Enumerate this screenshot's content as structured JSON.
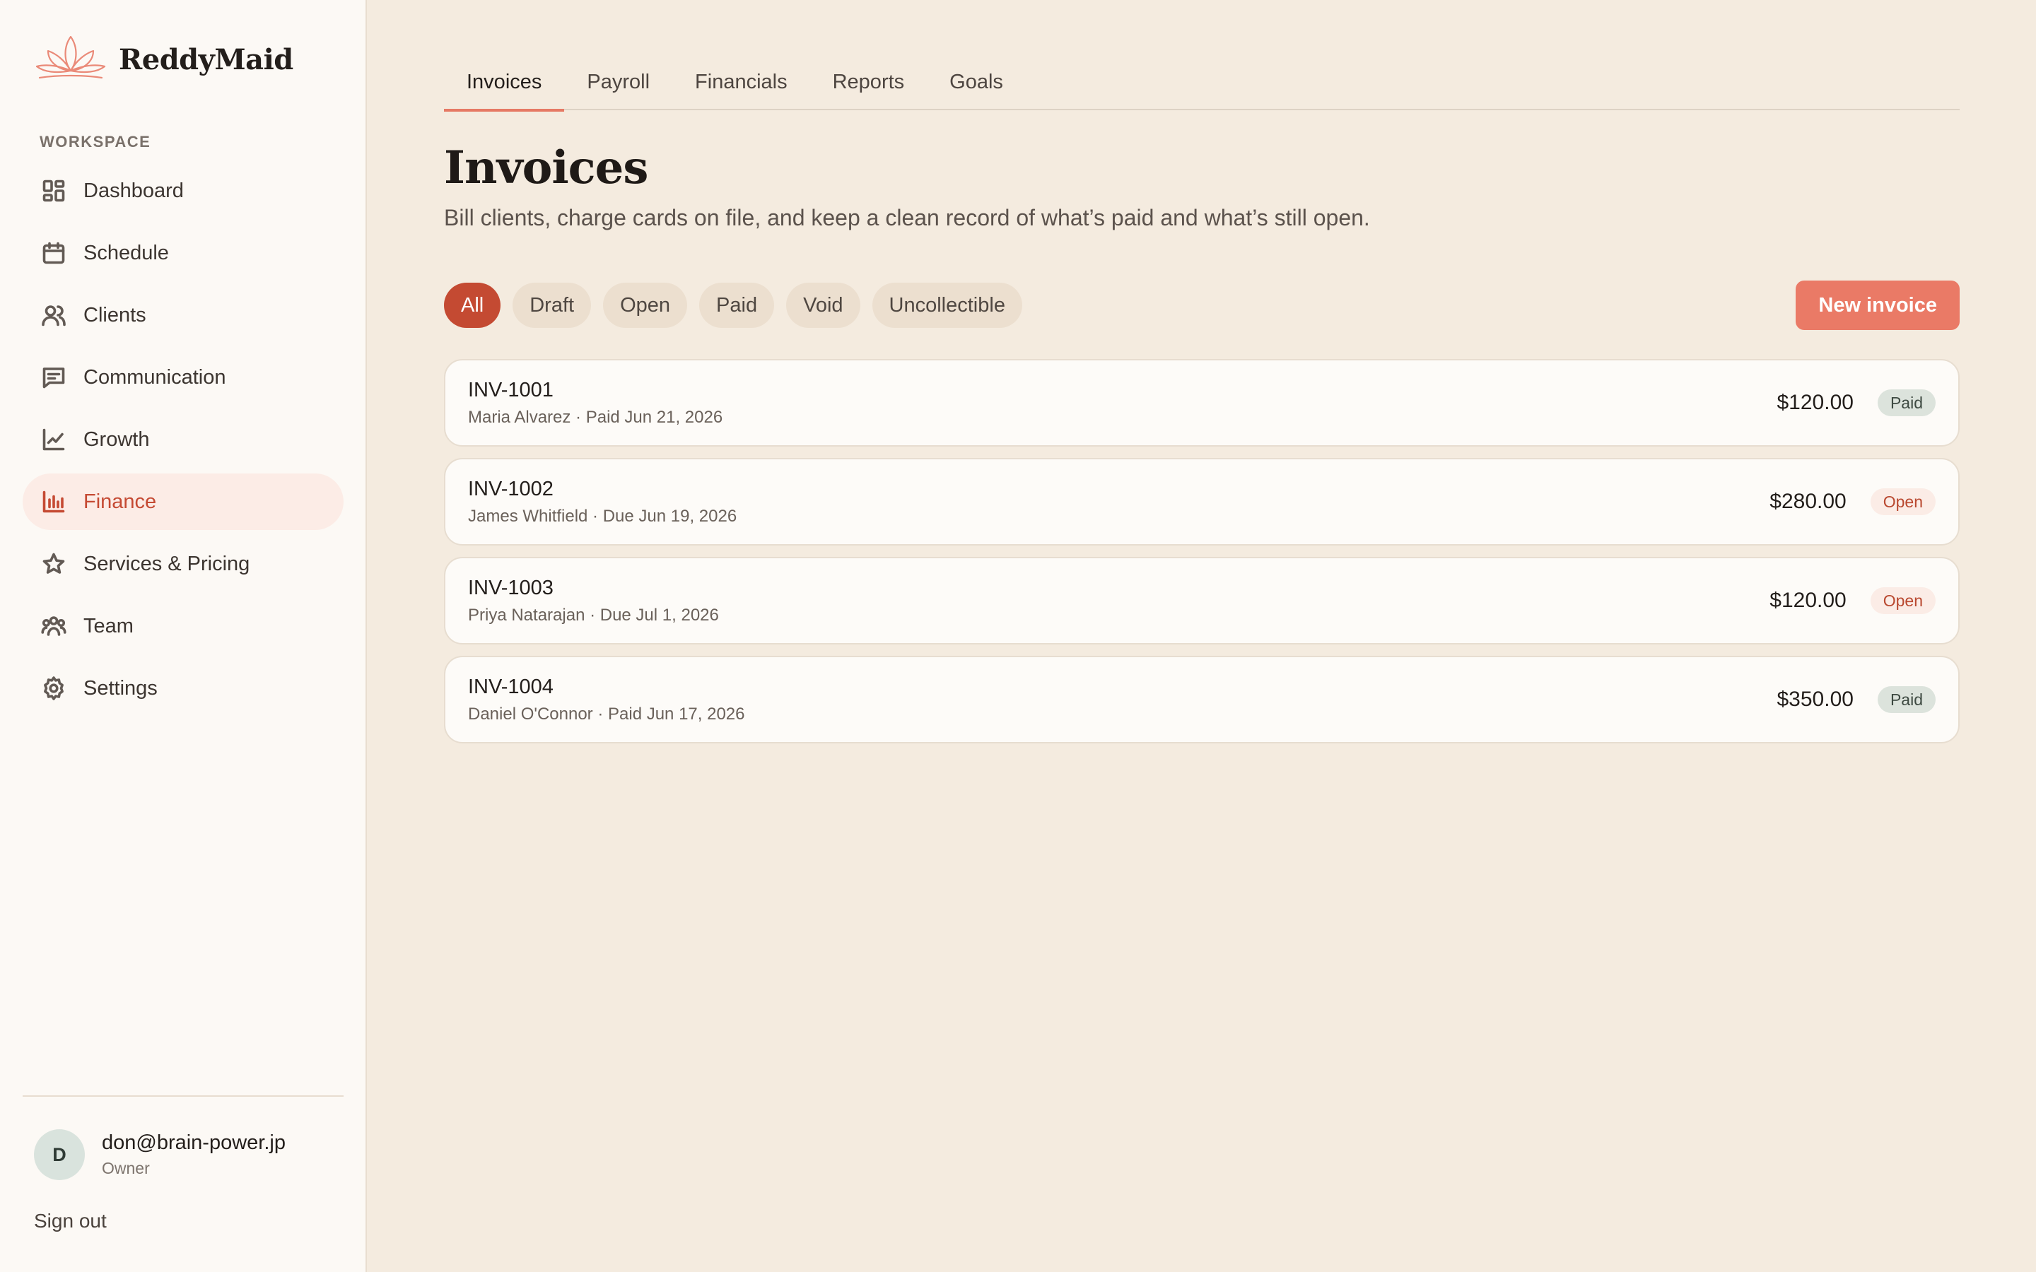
{
  "brand": {
    "name": "ReddyMaid",
    "logo_icon": "lotus-icon",
    "accent": "#e67964"
  },
  "sidebar": {
    "section_label": "WORKSPACE",
    "items": [
      {
        "label": "Dashboard",
        "icon": "dashboard-grid-icon"
      },
      {
        "label": "Schedule",
        "icon": "calendar-icon"
      },
      {
        "label": "Clients",
        "icon": "users-icon"
      },
      {
        "label": "Communication",
        "icon": "message-icon"
      },
      {
        "label": "Growth",
        "icon": "trend-chart-icon"
      },
      {
        "label": "Finance",
        "icon": "bar-chart-icon",
        "active": true
      },
      {
        "label": "Services & Pricing",
        "icon": "star-icon"
      },
      {
        "label": "Team",
        "icon": "team-icon"
      },
      {
        "label": "Settings",
        "icon": "gear-icon"
      }
    ],
    "user": {
      "initial": "D",
      "email": "don@brain-power.jp",
      "role": "Owner"
    },
    "sign_out": "Sign out"
  },
  "tabs": [
    {
      "label": "Invoices",
      "active": true
    },
    {
      "label": "Payroll"
    },
    {
      "label": "Financials"
    },
    {
      "label": "Reports"
    },
    {
      "label": "Goals"
    }
  ],
  "page": {
    "title": "Invoices",
    "subtitle": "Bill clients, charge cards on file, and keep a clean record of what’s paid and what’s still open."
  },
  "filters": [
    {
      "label": "All",
      "active": true
    },
    {
      "label": "Draft"
    },
    {
      "label": "Open"
    },
    {
      "label": "Paid"
    },
    {
      "label": "Void"
    },
    {
      "label": "Uncollectible"
    }
  ],
  "new_invoice_label": "New invoice",
  "invoices": [
    {
      "id": "INV-1001",
      "meta": "Maria Alvarez · Paid Jun 21, 2026",
      "amount": "$120.00",
      "status": "Paid"
    },
    {
      "id": "INV-1002",
      "meta": "James Whitfield · Due Jun 19, 2026",
      "amount": "$280.00",
      "status": "Open"
    },
    {
      "id": "INV-1003",
      "meta": "Priya Natarajan · Due Jul 1, 2026",
      "amount": "$120.00",
      "status": "Open"
    },
    {
      "id": "INV-1004",
      "meta": "Daniel O'Connor · Paid Jun 17, 2026",
      "amount": "$350.00",
      "status": "Paid"
    }
  ],
  "colors": {
    "primary": "#c44a32",
    "button": "#ea7a66",
    "paid_badge_bg": "#dce3dc",
    "open_badge_bg": "#fbece6",
    "page_bg": "#f4ebdf",
    "sidebar_bg": "#fcf9f5"
  }
}
